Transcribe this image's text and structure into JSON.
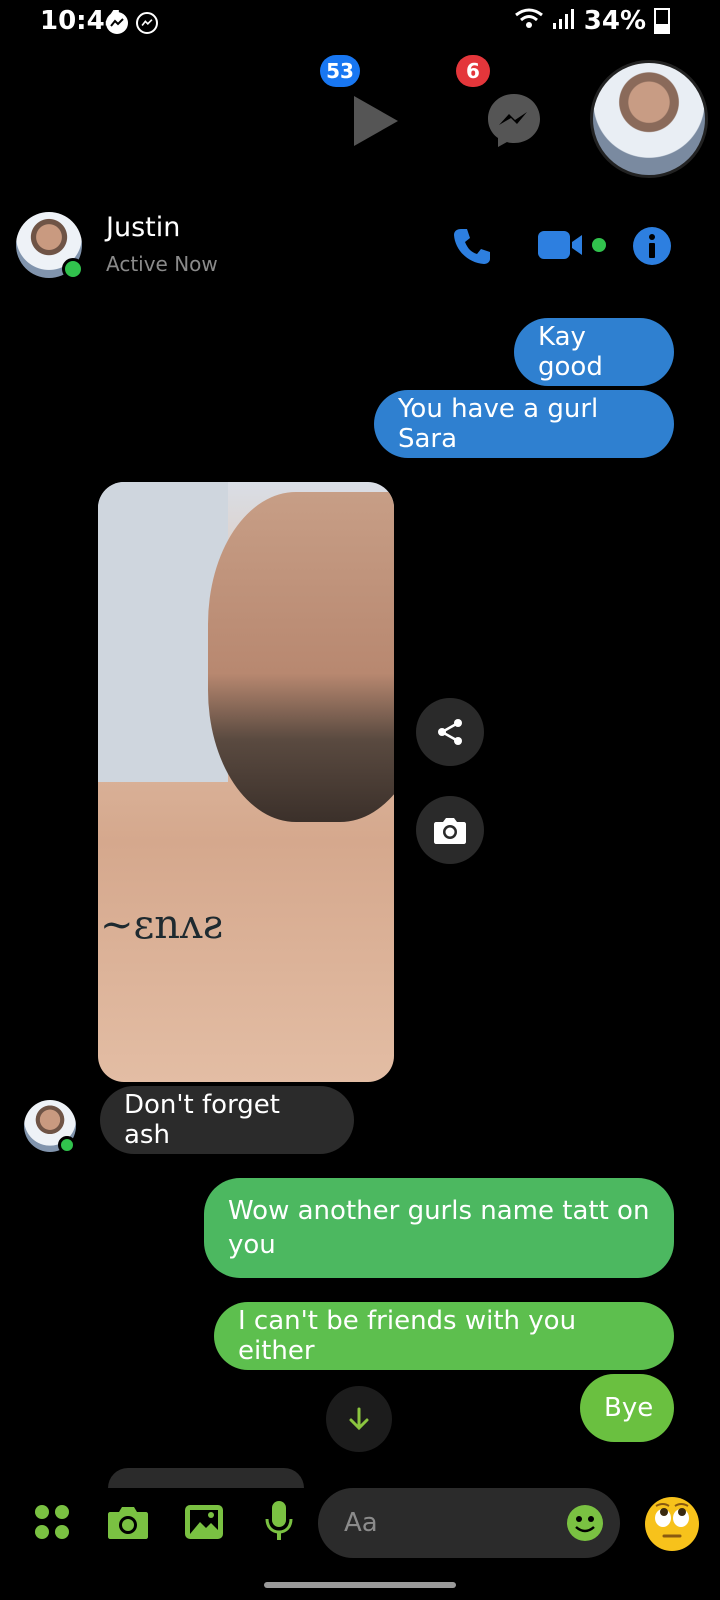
{
  "status_bar": {
    "time": "10:44",
    "battery": "34%"
  },
  "top_bar": {
    "stories_badge": "53",
    "messenger_badge": "6"
  },
  "header": {
    "name": "Justin",
    "status": "Active Now"
  },
  "messages": [
    {
      "text": "Kay good",
      "side": "sent"
    },
    {
      "text": "You have a gurl Sara",
      "side": "sent"
    },
    {
      "text": "Don't forget ash",
      "side": "received"
    },
    {
      "text": "Wow another gurls name tatt on you",
      "side": "sent"
    },
    {
      "text": "I can't be friends with you either",
      "side": "sent"
    },
    {
      "text": "Bye",
      "side": "sent"
    }
  ],
  "composer": {
    "placeholder": "Aa"
  },
  "colors": {
    "accent_blue": "#1877f2",
    "sent_blue": "#2f80d0",
    "sent_green": "#4cb860",
    "received_gray": "#2b2b2b",
    "online_green": "#31c24d"
  }
}
